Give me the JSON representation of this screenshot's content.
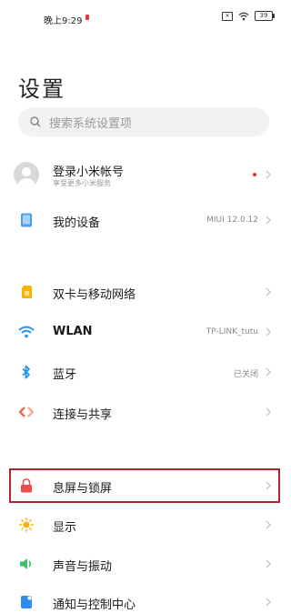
{
  "status_bar": {
    "time": "晚上9:29",
    "sim": "✕",
    "battery": "39"
  },
  "page": {
    "title": "设置"
  },
  "search": {
    "placeholder": "搜索系统设置项"
  },
  "account": {
    "title": "登录小米帐号",
    "subtitle": "享受更多小米服务"
  },
  "rows": [
    {
      "label": "我的设备",
      "value": "MIUI 12.0.12",
      "icon": "device-icon",
      "color": "#4a9fe8"
    },
    {
      "label": "双卡与移动网络",
      "value": "",
      "icon": "sim-card-icon",
      "color": "#f5b400"
    },
    {
      "label": "WLAN",
      "value": "TP-LINK_tutu",
      "icon": "wifi-icon",
      "color": "#2196f3"
    },
    {
      "label": "蓝牙",
      "value": "已关闭",
      "icon": "bluetooth-icon",
      "color": "#2196f3"
    },
    {
      "label": "连接与共享",
      "value": "",
      "icon": "share-icon",
      "color": "#f05a3a"
    },
    {
      "label": "息屏与锁屏",
      "value": "",
      "icon": "lock-icon",
      "color": "#ef4b4b"
    },
    {
      "label": "显示",
      "value": "",
      "icon": "sun-icon",
      "color": "#f5b400"
    },
    {
      "label": "声音与振动",
      "value": "",
      "icon": "speaker-icon",
      "color": "#3fbf6a"
    },
    {
      "label": "通知与控制中心",
      "value": "",
      "icon": "notification-icon",
      "color": "#2f8cf0"
    }
  ]
}
